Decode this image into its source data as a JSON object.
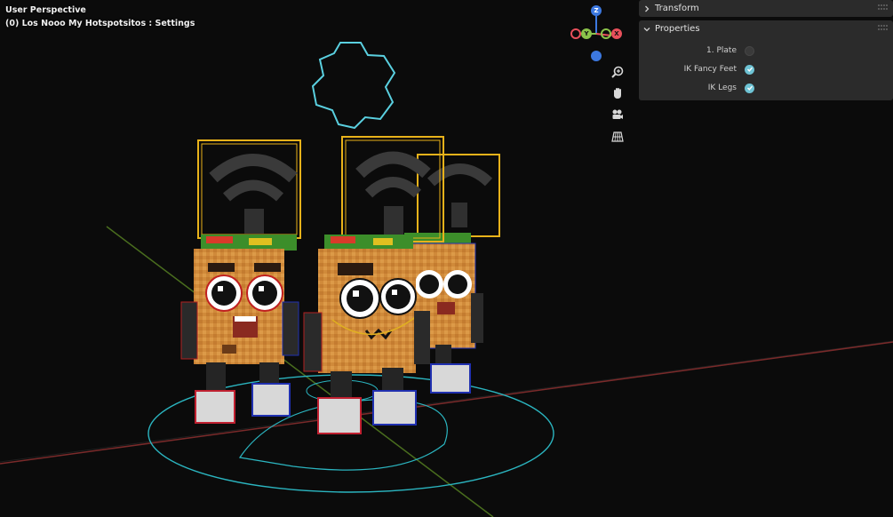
{
  "viewport": {
    "view_mode": "User Perspective",
    "scene_info": "(0) Los Nooo My Hotspotsitos : Settings"
  },
  "gizmo": {
    "z_label": "Z",
    "y_label": "Y",
    "x_label": "X",
    "colors": {
      "x": "#e8505b",
      "y": "#8bc34a",
      "z": "#3c78e0"
    }
  },
  "nav_tools": [
    {
      "name": "zoom",
      "icon": "zoom-icon"
    },
    {
      "name": "pan",
      "icon": "hand-icon"
    },
    {
      "name": "camera",
      "icon": "camera-icon"
    },
    {
      "name": "perspective",
      "icon": "grid-icon"
    }
  ],
  "panels": {
    "transform": {
      "title": "Transform",
      "expanded": false
    },
    "properties": {
      "title": "Properties",
      "expanded": true,
      "items": [
        {
          "label": "1. Plate",
          "checked": false
        },
        {
          "label": "IK Fancy Feet",
          "checked": true
        },
        {
          "label": "IK Legs",
          "checked": true
        }
      ]
    }
  },
  "colors": {
    "background": "#0b0b0b",
    "panel": "#2b2b2b",
    "check_on": "#6ec3d4",
    "bone_cyan": "#3ec6d2",
    "bone_yellow": "#f0c020",
    "bone_red": "#d0303a",
    "bone_blue": "#3040c8"
  }
}
